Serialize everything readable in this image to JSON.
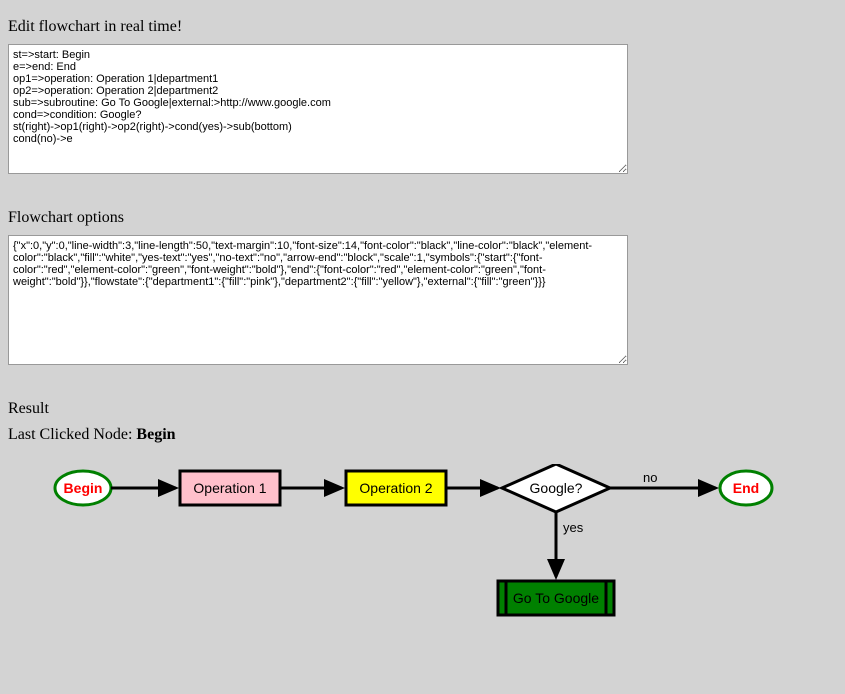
{
  "headings": {
    "edit": "Edit flowchart in real time!",
    "options": "Flowchart options",
    "result": "Result"
  },
  "textareas": {
    "source": "st=>start: Begin\ne=>end: End\nop1=>operation: Operation 1|department1\nop2=>operation: Operation 2|department2\nsub=>subroutine: Go To Google|external:>http://www.google.com\ncond=>condition: Google?\nst(right)->op1(right)->op2(right)->cond(yes)->sub(bottom)\ncond(no)->e",
    "options": "{\"x\":0,\"y\":0,\"line-width\":3,\"line-length\":50,\"text-margin\":10,\"font-size\":14,\"font-color\":\"black\",\"line-color\":\"black\",\"element-color\":\"black\",\"fill\":\"white\",\"yes-text\":\"yes\",\"no-text\":\"no\",\"arrow-end\":\"block\",\"scale\":1,\"symbols\":{\"start\":{\"font-color\":\"red\",\"element-color\":\"green\",\"font-weight\":\"bold\"},\"end\":{\"font-color\":\"red\",\"element-color\":\"green\",\"font-weight\":\"bold\"}},\"flowstate\":{\"department1\":{\"fill\":\"pink\"},\"department2\":{\"fill\":\"yellow\"},\"external\":{\"fill\":\"green\"}}}"
  },
  "lastClicked": {
    "labelPrefix": "Last Clicked Node: ",
    "value": "Begin"
  },
  "flowchart": {
    "nodes": {
      "start": "Begin",
      "op1": "Operation 1",
      "op2": "Operation 2",
      "cond": "Google?",
      "end": "End",
      "sub": "Go To Google"
    },
    "edges": {
      "yes": "yes",
      "no": "no"
    },
    "colors": {
      "startStroke": "green",
      "startText": "red",
      "endStroke": "green",
      "endText": "red",
      "op1Fill": "pink",
      "op2Fill": "yellow",
      "subFill": "green",
      "line": "black"
    }
  }
}
